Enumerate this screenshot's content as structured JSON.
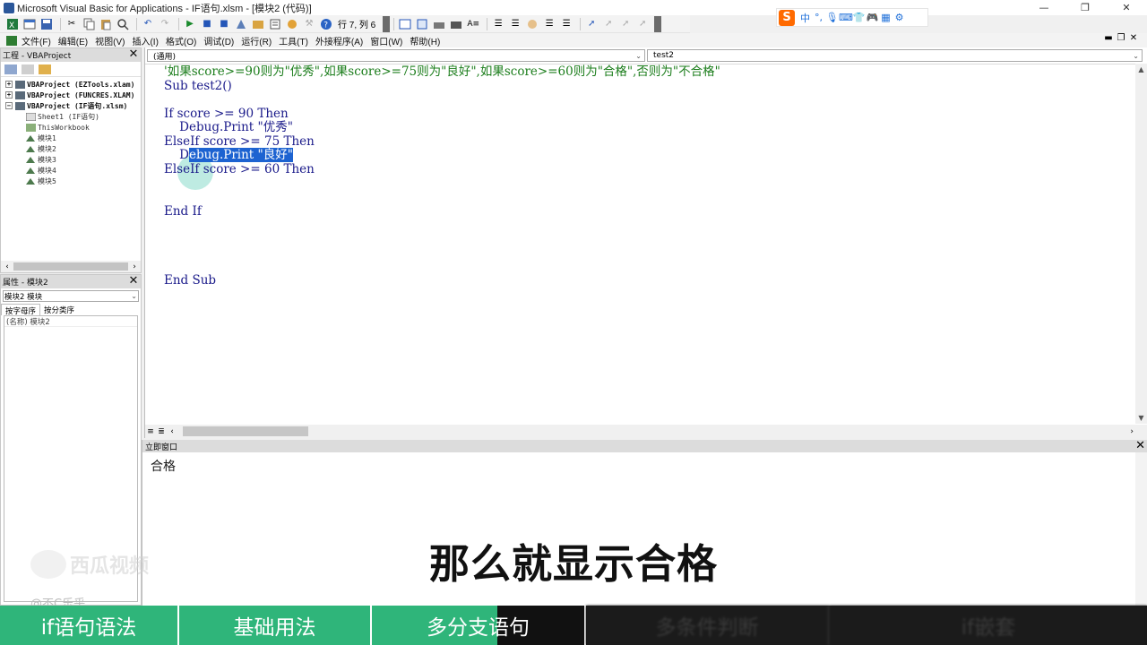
{
  "window": {
    "title": "Microsoft Visual Basic for Applications - IF语句.xlsm - [模块2 (代码)]",
    "controls": [
      "—",
      "❐",
      "✕"
    ]
  },
  "toolbar": {
    "status": "行 7, 列 6"
  },
  "ime": {
    "label": "中"
  },
  "menu": {
    "items": [
      "文件(F)",
      "编辑(E)",
      "视图(V)",
      "插入(I)",
      "格式(O)",
      "调试(D)",
      "运行(R)",
      "工具(T)",
      "外接程序(A)",
      "窗口(W)",
      "帮助(H)"
    ]
  },
  "project_panel": {
    "title": "工程 - VBAProject",
    "tree": [
      {
        "label": "VBAProject (EZTools.xlam)",
        "level": 0
      },
      {
        "label": "VBAProject (FUNCRES.XLAM)",
        "level": 0
      },
      {
        "label": "VBAProject (IF语句.xlsm)",
        "level": 0
      },
      {
        "label": "Sheet1 (IF语句)",
        "level": 1
      },
      {
        "label": "ThisWorkbook",
        "level": 1
      },
      {
        "label": "模块1",
        "level": 1
      },
      {
        "label": "模块2",
        "level": 1
      },
      {
        "label": "模块3",
        "level": 1
      },
      {
        "label": "模块4",
        "level": 1
      },
      {
        "label": "模块5",
        "level": 1
      }
    ]
  },
  "properties_panel": {
    "title": "属性 - 模块2",
    "object": "模块2 模块",
    "tabs": [
      "按字母序",
      "按分类序"
    ],
    "row": "(名称) 模块2"
  },
  "code_window": {
    "object_combo": "(通用)",
    "proc_combo": "test2",
    "lines": {
      "l1": "'如果score>=90则为\"优秀\",如果score>=75则为\"良好\",如果score>=60则为\"合格\",否则为\"不合格\"",
      "l2": "Sub test2()",
      "l3": "If score >= 90 Then",
      "l4": "    Debug.Print \"优秀\"",
      "l5": "ElseIf score >= 75 Then",
      "l6_pre": "    D",
      "l6_sel": "ebug.Print \"良好\"",
      "l7": "ElseIf score >= 60 Then",
      "l8": "End If",
      "l9": "End Sub"
    }
  },
  "immediate": {
    "title": "立即窗口",
    "output": "合格"
  },
  "video": {
    "watermark": "西瓜视频",
    "user": "@不C乐乎",
    "subtitle": "那么就显示合格",
    "chapters": [
      "if语句语法",
      "基础用法",
      "多分支语句",
      "多条件判断",
      "if嵌套"
    ]
  },
  "colors": {
    "chapter_active": "#2fb57a",
    "keyword": "#1a1a8a",
    "comment": "#1b7d1b",
    "selection": "#1d63d1"
  }
}
